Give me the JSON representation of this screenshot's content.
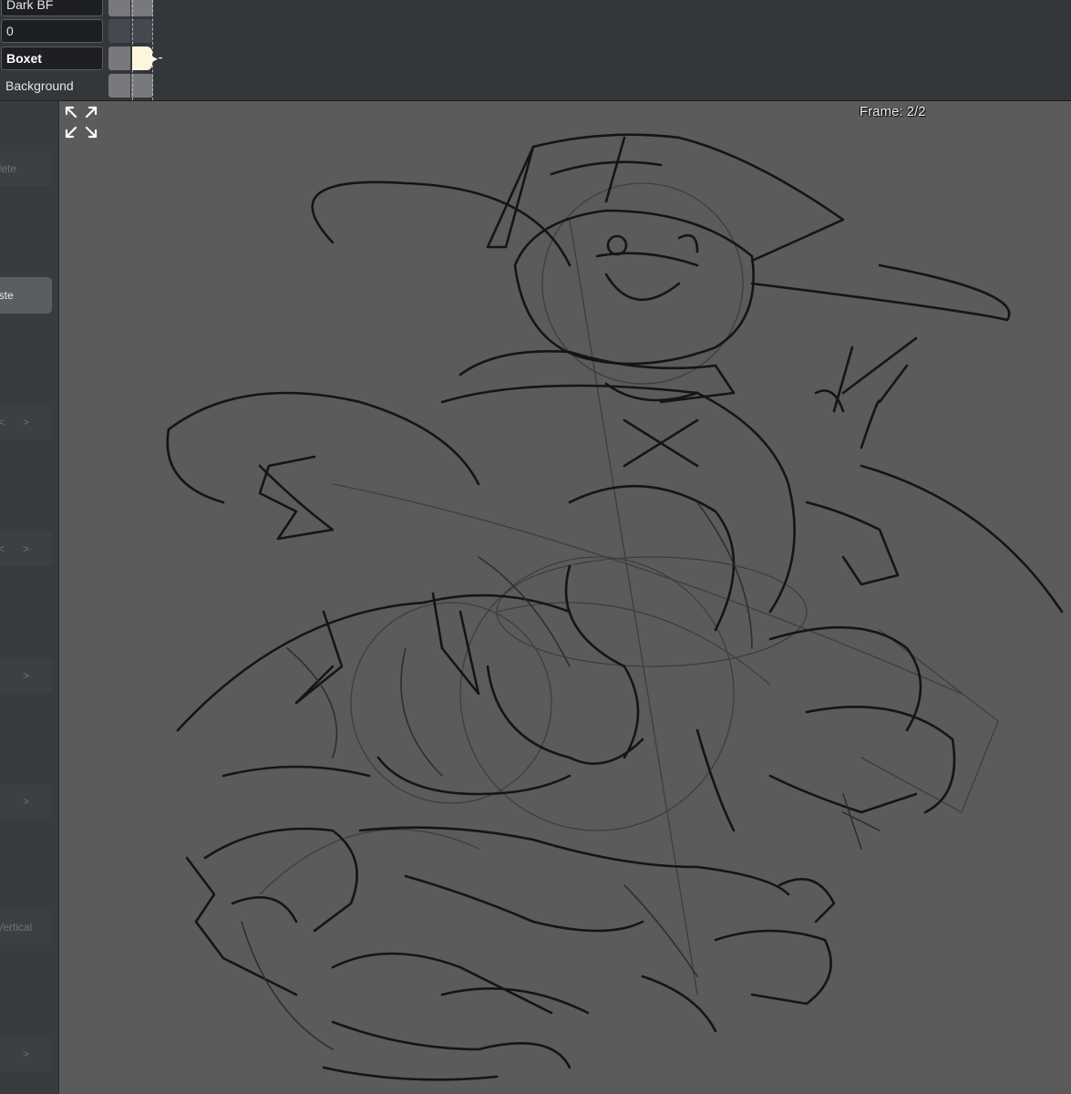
{
  "layers": [
    {
      "name": "Dark BF",
      "selected": false,
      "boxed": true
    },
    {
      "name": "0",
      "selected": false,
      "boxed": true
    },
    {
      "name": "Boxet",
      "selected": true,
      "boxed": true
    },
    {
      "name": "Background",
      "selected": false,
      "boxed": false
    }
  ],
  "sidebar": {
    "delete_label": "elete",
    "paste_label": "aste",
    "vertical_label": "Vertical",
    "nav": [
      {
        "prev": "<",
        "next": ">"
      },
      {
        "prev": "<",
        "next": ">"
      },
      {
        "prev": "",
        "next": ">"
      },
      {
        "prev": "",
        "next": ">"
      },
      {
        "prev": "",
        "next": ">"
      }
    ]
  },
  "canvas": {
    "frame_label": "Frame: 2/2",
    "fullscreen_icon": "expand-arrows-icon",
    "background_color": "#5b5b5b",
    "stroke_color": "#151515"
  },
  "colors": {
    "panel_bg": "#33363b",
    "playhead": "#fdf6dd"
  }
}
